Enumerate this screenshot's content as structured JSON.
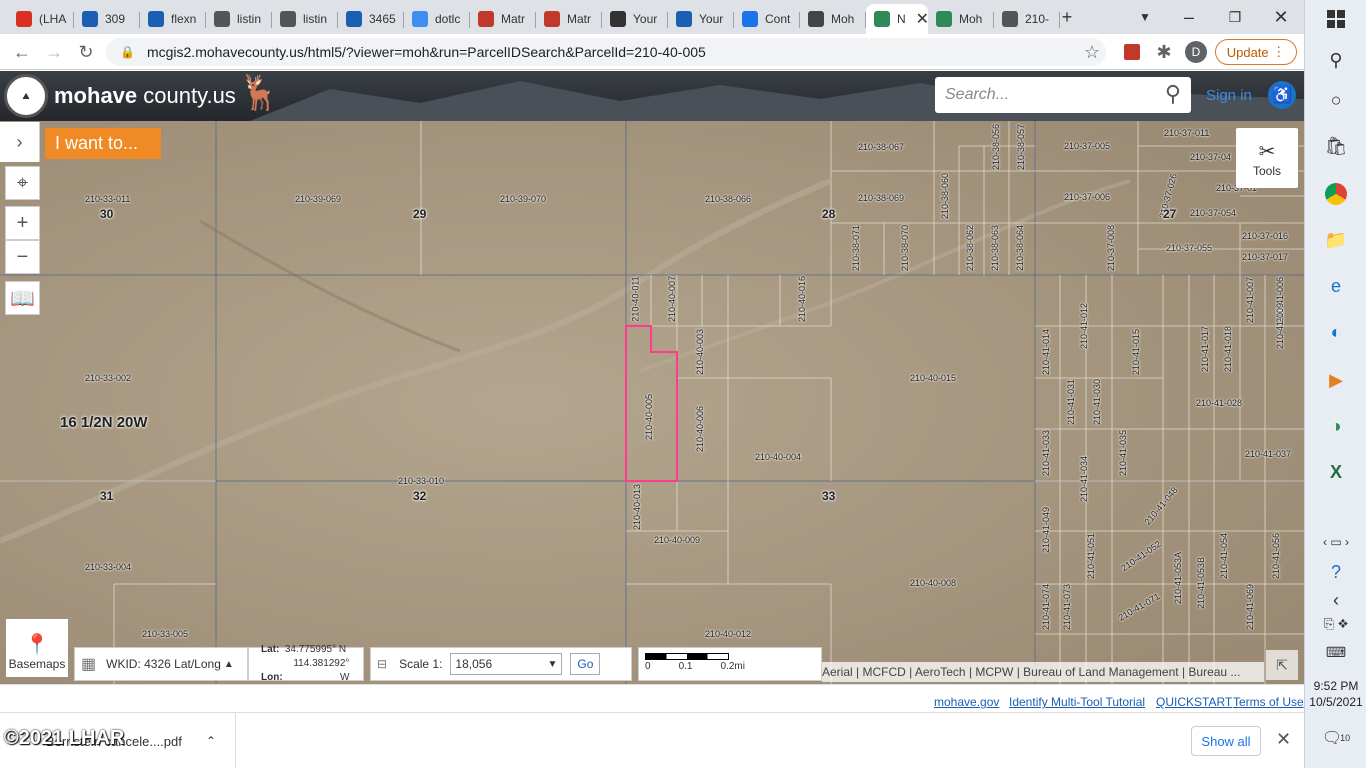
{
  "browser": {
    "tabs": [
      {
        "label": "(LHA",
        "icon": "gmail-icon",
        "color": "#d93025"
      },
      {
        "label": "309",
        "icon": "flexmls-icon",
        "color": "#1a5fb4"
      },
      {
        "label": "flexn",
        "icon": "flexmls-icon",
        "color": "#1a5fb4"
      },
      {
        "label": "listin",
        "icon": "globe-icon",
        "color": "#555"
      },
      {
        "label": "listin",
        "icon": "globe-icon",
        "color": "#555"
      },
      {
        "label": "3465",
        "icon": "flexmls-icon",
        "color": "#1a5fb4"
      },
      {
        "label": "dotlc",
        "icon": "dotloop-icon",
        "color": "#3d8ef0"
      },
      {
        "label": "Matr",
        "icon": "matrix-icon",
        "color": "#c0392b"
      },
      {
        "label": "Matr",
        "icon": "matrix-icon",
        "color": "#c0392b"
      },
      {
        "label": "Your",
        "icon": "at-icon",
        "color": "#333"
      },
      {
        "label": "Your",
        "icon": "you-icon",
        "color": "#1a5fb4"
      },
      {
        "label": "Cont",
        "icon": "z-icon",
        "color": "#1a73e8"
      },
      {
        "label": "Moh",
        "icon": "mohave-icon",
        "color": "#444"
      },
      {
        "label": "N",
        "icon": "map-icon",
        "color": "#2e8b57"
      },
      {
        "label": "Moh",
        "icon": "map-icon",
        "color": "#2e8b57"
      },
      {
        "label": "210-",
        "icon": "globe-icon",
        "color": "#555"
      }
    ],
    "new_tab": "+",
    "url": "mcgis2.mohavecounty.us/html5/?viewer=moh&run=ParcelIDSearch&ParcelId=210-40-005",
    "update_label": "Update",
    "profile_initial": "D"
  },
  "app": {
    "brand_bold": "mohave",
    "brand_rest": " county.us",
    "search_placeholder": "Search...",
    "signin": "Sign in",
    "i_want_to": "I want to...",
    "tools": "Tools",
    "basemaps": "Basemaps",
    "wkid": "WKID: 4326 Lat/Long",
    "lat_label": "Lat:",
    "lat_value": "34.775995° N",
    "lon_label": "Lon:",
    "lon_value": "114.381292° W",
    "scale_label": "Scale 1:",
    "scale_value": "18,056",
    "go": "Go",
    "scale_ticks": [
      "0",
      "0.1",
      "0.2mi"
    ],
    "attribution": "Aerial | MCFCD | AeroTech | MCPW | Bureau of Land Management | Bureau ...",
    "footer_links": [
      "mohave.gov",
      "Identify Multi-Tool Tutorial",
      "QUICKSTART",
      "Terms of Use"
    ]
  },
  "map": {
    "township": "16 1/2N 20W",
    "sections": [
      "30",
      "29",
      "28",
      "31",
      "32",
      "33",
      "27"
    ],
    "parcels": [
      "210-33-011",
      "210-39-069",
      "210-39-070",
      "210-38-066",
      "210-38-067",
      "210-38-069",
      "210-37-011",
      "210-37-005",
      "210-37-006",
      "210-37-054",
      "210-37-055",
      "210-37-016",
      "210-37-017",
      "210-33-002",
      "210-40-015",
      "210-41-028",
      "210-40-004",
      "210-41-037",
      "210-33-010",
      "210-40-009",
      "210-33-004",
      "210-40-008",
      "210-33-005",
      "210-40-012",
      "210-40-011",
      "210-40-007",
      "210-40-016",
      "210-40-003",
      "210-40-005",
      "210-40-006",
      "210-40-013",
      "210-41-014",
      "210-41-012",
      "210-41-015",
      "210-41-007",
      "210-41-006",
      "210-41-017",
      "210-41-018",
      "210-41-031",
      "210-41-030",
      "210-41-033",
      "210-41-034",
      "210-41-035",
      "210-41-049",
      "210-41-051",
      "210-41-052",
      "210-41-053A",
      "210-41-053B",
      "210-41-054",
      "210-41-056",
      "210-41-074",
      "210-41-073",
      "210-41-071",
      "210-41-069",
      "210-41-048",
      "210-41-009",
      "210-38-071",
      "210-38-070",
      "210-38-060",
      "210-38-062",
      "210-38-063",
      "210-38-064",
      "210-37-008",
      "210-37-026",
      "210-38-056",
      "210-38-057",
      "210-37-04",
      "210-37-01"
    ]
  },
  "downloads": {
    "file": "Bernstein cancele....pdf",
    "show_all": "Show all",
    "watermark": "©2021 LHAR"
  },
  "taskbar": {
    "time": "9:52 PM",
    "date": "10/5/2021",
    "notif_count": "10"
  }
}
